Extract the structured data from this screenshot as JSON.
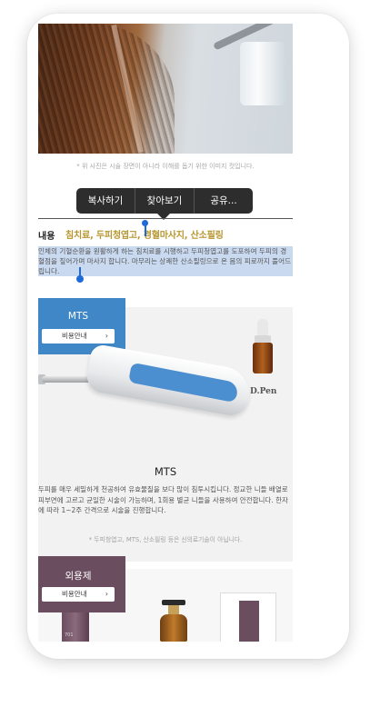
{
  "hero": {
    "caption": "* 위 사진은 시술 장면이 아니라 이해를 돕기 위한 이미지 컷입니다."
  },
  "context_menu": {
    "copy": "복사하기",
    "lookup": "찾아보기",
    "share": "공유..."
  },
  "content": {
    "label": "내용",
    "tags": "침치료, 두피청엽고, 경혈마사지, 산소필링",
    "description": "인체의 기혈순환을 원활하게 하는 침치료를 시행하고 두피청엽고를 도포하여 두피의 경혈점을 짚어가며 마사지 합니다. 마무리는 상쾌한 산소필링으로 온 몸의 피로까지 풀어드립니다."
  },
  "mts": {
    "tag_title": "MTS",
    "price_button": "비용안내",
    "device_label": "D.Pen",
    "title": "MTS",
    "description": "두피를 매우 세밀하게 천공하여 유효물질을 보다 많이 침투시킵니다. 정교한 니들 배열로 피부면에 고르고 균일한 시술이 가능하며, 1회용 별균 니들을 사용하여 안전합니다. 한자에 따라 1~2주 간격으로 시술을 진행합니다.",
    "note": "* 두피청엽고, MTS, 산소필링 등은 신의료기술이 아닙니다."
  },
  "external": {
    "tag_title": "외용제",
    "price_button": "비용안내",
    "product_label": "701"
  },
  "colors": {
    "mts_tag": "#3f87c6",
    "external_tag": "#6a4d5e",
    "tag_text": "#b7962f",
    "selection": "#c9d9ef"
  }
}
